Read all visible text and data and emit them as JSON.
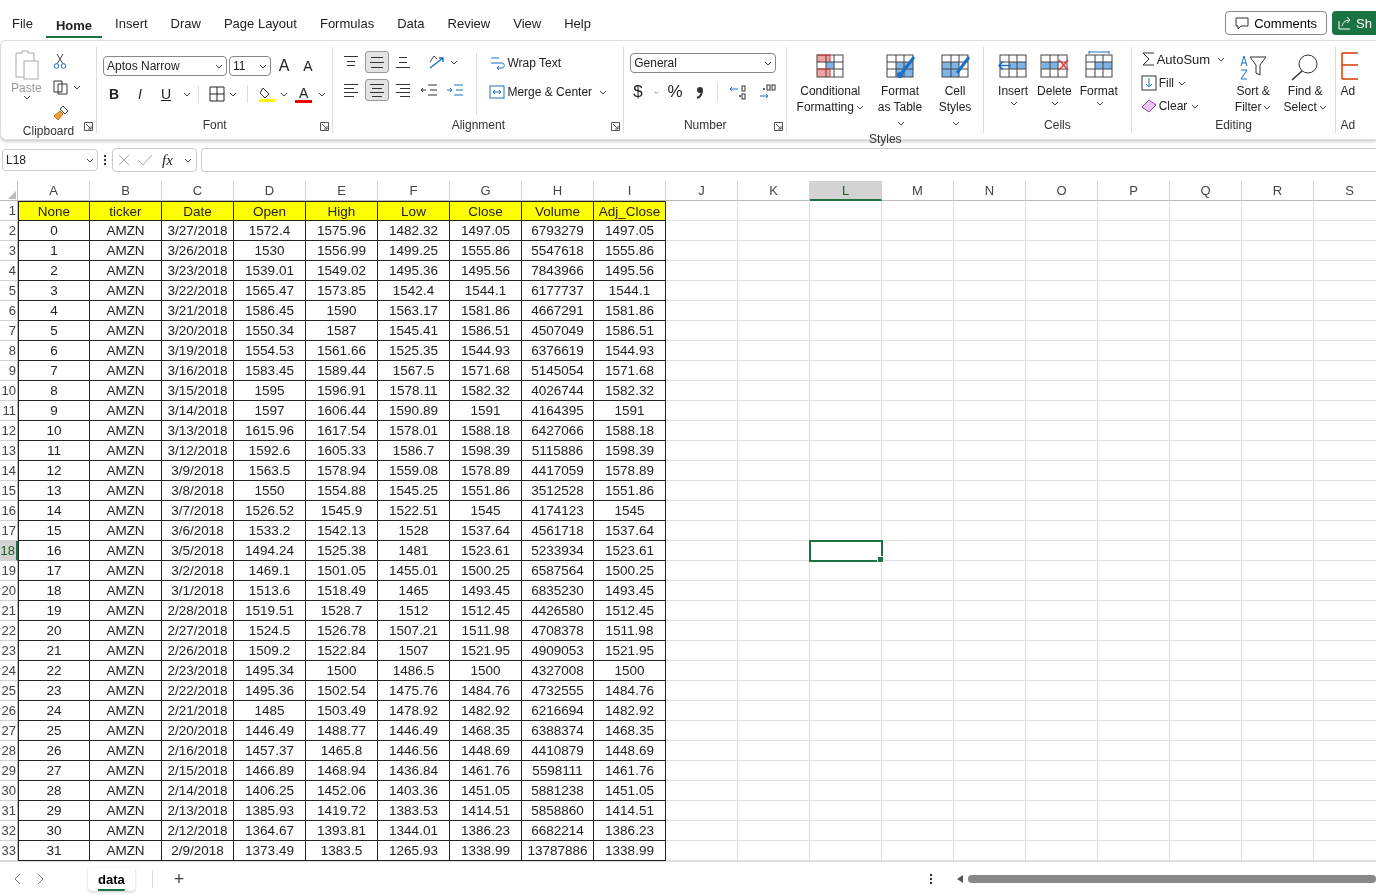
{
  "menu_tabs": [
    {
      "label": "File",
      "selected": false
    },
    {
      "label": "Home",
      "selected": true
    },
    {
      "label": "Insert",
      "selected": false
    },
    {
      "label": "Draw",
      "selected": false
    },
    {
      "label": "Page Layout",
      "selected": false
    },
    {
      "label": "Formulas",
      "selected": false
    },
    {
      "label": "Data",
      "selected": false
    },
    {
      "label": "Review",
      "selected": false
    },
    {
      "label": "View",
      "selected": false
    },
    {
      "label": "Help",
      "selected": false
    }
  ],
  "comments_button": "Comments",
  "share_button": "Sh",
  "ribbon": {
    "clipboard": {
      "title": "Clipboard",
      "paste": {
        "label": "Paste",
        "disabled": true
      }
    },
    "font": {
      "title": "Font",
      "font_name": "Aptos Narrow",
      "font_size": "11",
      "grow": "A",
      "shrink": "A",
      "bold": "B",
      "italic": "I",
      "underline": "U",
      "font_color": "A"
    },
    "alignment": {
      "title": "Alignment",
      "vertical": [
        {
          "kind": "top",
          "selected": false
        },
        {
          "kind": "middle",
          "selected": true
        },
        {
          "kind": "bottom",
          "selected": false
        }
      ],
      "horizontal": [
        {
          "kind": "left",
          "selected": false
        },
        {
          "kind": "center",
          "selected": true
        },
        {
          "kind": "right",
          "selected": false
        }
      ],
      "wrap_text": "Wrap Text",
      "merge_center": "Merge & Center"
    },
    "number": {
      "title": "Number",
      "format": "General",
      "currency": "$",
      "percent": "%"
    },
    "styles": {
      "title": "Styles",
      "buttons": [
        {
          "kind": "conditional",
          "label": "Conditional Formatting"
        },
        {
          "kind": "table",
          "label": "Format as Table"
        },
        {
          "kind": "cell_styles",
          "label": "Cell Styles"
        }
      ]
    },
    "cells": {
      "title": "Cells",
      "buttons": [
        {
          "kind": "insert",
          "label": "Insert"
        },
        {
          "kind": "delete",
          "label": "Delete"
        },
        {
          "kind": "format",
          "label": "Format"
        }
      ]
    },
    "editing": {
      "title": "Editing",
      "autosum": "AutoSum",
      "fill": "Fill",
      "clear": "Clear",
      "sort_filter": "Sort & Filter",
      "find_select": "Find & Select"
    },
    "add": {
      "label": "Ad",
      "title": "Ad"
    }
  },
  "formula_bar": {
    "name_box": "L18",
    "fx": "fx"
  },
  "sheet": {
    "columns": [
      {
        "label": "A",
        "selected": false
      },
      {
        "label": "B",
        "selected": false
      },
      {
        "label": "C",
        "selected": false
      },
      {
        "label": "D",
        "selected": false
      },
      {
        "label": "E",
        "selected": false
      },
      {
        "label": "F",
        "selected": false
      },
      {
        "label": "G",
        "selected": false
      },
      {
        "label": "H",
        "selected": false
      },
      {
        "label": "I",
        "selected": false
      },
      {
        "label": "J",
        "selected": false
      },
      {
        "label": "K",
        "selected": false
      },
      {
        "label": "L",
        "selected": true
      },
      {
        "label": "M",
        "selected": false
      },
      {
        "label": "N",
        "selected": false
      },
      {
        "label": "O",
        "selected": false
      },
      {
        "label": "P",
        "selected": false
      },
      {
        "label": "Q",
        "selected": false
      },
      {
        "label": "R",
        "selected": false
      },
      {
        "label": "S",
        "selected": false
      }
    ],
    "rows": [
      {
        "number": "1",
        "selected": false,
        "kind": "header",
        "cells": [
          "None",
          "ticker",
          "Date",
          "Open",
          "High",
          "Low",
          "Close",
          "Volume",
          "Adj_Close"
        ]
      },
      {
        "number": "2",
        "selected": false,
        "kind": "data",
        "cells": [
          "0",
          "AMZN",
          "3/27/2018",
          "1572.4",
          "1575.96",
          "1482.32",
          "1497.05",
          "6793279",
          "1497.05"
        ]
      },
      {
        "number": "3",
        "selected": false,
        "kind": "data",
        "cells": [
          "1",
          "AMZN",
          "3/26/2018",
          "1530",
          "1556.99",
          "1499.25",
          "1555.86",
          "5547618",
          "1555.86"
        ]
      },
      {
        "number": "4",
        "selected": false,
        "kind": "data",
        "cells": [
          "2",
          "AMZN",
          "3/23/2018",
          "1539.01",
          "1549.02",
          "1495.36",
          "1495.56",
          "7843966",
          "1495.56"
        ]
      },
      {
        "number": "5",
        "selected": false,
        "kind": "data",
        "cells": [
          "3",
          "AMZN",
          "3/22/2018",
          "1565.47",
          "1573.85",
          "1542.4",
          "1544.1",
          "6177737",
          "1544.1"
        ]
      },
      {
        "number": "6",
        "selected": false,
        "kind": "data",
        "cells": [
          "4",
          "AMZN",
          "3/21/2018",
          "1586.45",
          "1590",
          "1563.17",
          "1581.86",
          "4667291",
          "1581.86"
        ]
      },
      {
        "number": "7",
        "selected": false,
        "kind": "data",
        "cells": [
          "5",
          "AMZN",
          "3/20/2018",
          "1550.34",
          "1587",
          "1545.41",
          "1586.51",
          "4507049",
          "1586.51"
        ]
      },
      {
        "number": "8",
        "selected": false,
        "kind": "data",
        "cells": [
          "6",
          "AMZN",
          "3/19/2018",
          "1554.53",
          "1561.66",
          "1525.35",
          "1544.93",
          "6376619",
          "1544.93"
        ]
      },
      {
        "number": "9",
        "selected": false,
        "kind": "data",
        "cells": [
          "7",
          "AMZN",
          "3/16/2018",
          "1583.45",
          "1589.44",
          "1567.5",
          "1571.68",
          "5145054",
          "1571.68"
        ]
      },
      {
        "number": "10",
        "selected": false,
        "kind": "data",
        "cells": [
          "8",
          "AMZN",
          "3/15/2018",
          "1595",
          "1596.91",
          "1578.11",
          "1582.32",
          "4026744",
          "1582.32"
        ]
      },
      {
        "number": "11",
        "selected": false,
        "kind": "data",
        "cells": [
          "9",
          "AMZN",
          "3/14/2018",
          "1597",
          "1606.44",
          "1590.89",
          "1591",
          "4164395",
          "1591"
        ]
      },
      {
        "number": "12",
        "selected": false,
        "kind": "data",
        "cells": [
          "10",
          "AMZN",
          "3/13/2018",
          "1615.96",
          "1617.54",
          "1578.01",
          "1588.18",
          "6427066",
          "1588.18"
        ]
      },
      {
        "number": "13",
        "selected": false,
        "kind": "data",
        "cells": [
          "11",
          "AMZN",
          "3/12/2018",
          "1592.6",
          "1605.33",
          "1586.7",
          "1598.39",
          "5115886",
          "1598.39"
        ]
      },
      {
        "number": "14",
        "selected": false,
        "kind": "data",
        "cells": [
          "12",
          "AMZN",
          "3/9/2018",
          "1563.5",
          "1578.94",
          "1559.08",
          "1578.89",
          "4417059",
          "1578.89"
        ]
      },
      {
        "number": "15",
        "selected": false,
        "kind": "data",
        "cells": [
          "13",
          "AMZN",
          "3/8/2018",
          "1550",
          "1554.88",
          "1545.25",
          "1551.86",
          "3512528",
          "1551.86"
        ]
      },
      {
        "number": "16",
        "selected": false,
        "kind": "data",
        "cells": [
          "14",
          "AMZN",
          "3/7/2018",
          "1526.52",
          "1545.9",
          "1522.51",
          "1545",
          "4174123",
          "1545"
        ]
      },
      {
        "number": "17",
        "selected": false,
        "kind": "data",
        "cells": [
          "15",
          "AMZN",
          "3/6/2018",
          "1533.2",
          "1542.13",
          "1528",
          "1537.64",
          "4561718",
          "1537.64"
        ]
      },
      {
        "number": "18",
        "selected": true,
        "kind": "data",
        "cells": [
          "16",
          "AMZN",
          "3/5/2018",
          "1494.24",
          "1525.38",
          "1481",
          "1523.61",
          "5233934",
          "1523.61"
        ]
      },
      {
        "number": "19",
        "selected": false,
        "kind": "data",
        "cells": [
          "17",
          "AMZN",
          "3/2/2018",
          "1469.1",
          "1501.05",
          "1455.01",
          "1500.25",
          "6587564",
          "1500.25"
        ]
      },
      {
        "number": "20",
        "selected": false,
        "kind": "data",
        "cells": [
          "18",
          "AMZN",
          "3/1/2018",
          "1513.6",
          "1518.49",
          "1465",
          "1493.45",
          "6835230",
          "1493.45"
        ]
      },
      {
        "number": "21",
        "selected": false,
        "kind": "data",
        "cells": [
          "19",
          "AMZN",
          "2/28/2018",
          "1519.51",
          "1528.7",
          "1512",
          "1512.45",
          "4426580",
          "1512.45"
        ]
      },
      {
        "number": "22",
        "selected": false,
        "kind": "data",
        "cells": [
          "20",
          "AMZN",
          "2/27/2018",
          "1524.5",
          "1526.78",
          "1507.21",
          "1511.98",
          "4708378",
          "1511.98"
        ]
      },
      {
        "number": "23",
        "selected": false,
        "kind": "data",
        "cells": [
          "21",
          "AMZN",
          "2/26/2018",
          "1509.2",
          "1522.84",
          "1507",
          "1521.95",
          "4909053",
          "1521.95"
        ]
      },
      {
        "number": "24",
        "selected": false,
        "kind": "data",
        "cells": [
          "22",
          "AMZN",
          "2/23/2018",
          "1495.34",
          "1500",
          "1486.5",
          "1500",
          "4327008",
          "1500"
        ]
      },
      {
        "number": "25",
        "selected": false,
        "kind": "data",
        "cells": [
          "23",
          "AMZN",
          "2/22/2018",
          "1495.36",
          "1502.54",
          "1475.76",
          "1484.76",
          "4732555",
          "1484.76"
        ]
      },
      {
        "number": "26",
        "selected": false,
        "kind": "data",
        "cells": [
          "24",
          "AMZN",
          "2/21/2018",
          "1485",
          "1503.49",
          "1478.92",
          "1482.92",
          "6216694",
          "1482.92"
        ]
      },
      {
        "number": "27",
        "selected": false,
        "kind": "data",
        "cells": [
          "25",
          "AMZN",
          "2/20/2018",
          "1446.49",
          "1488.77",
          "1446.49",
          "1468.35",
          "6388374",
          "1468.35"
        ]
      },
      {
        "number": "28",
        "selected": false,
        "kind": "data",
        "cells": [
          "26",
          "AMZN",
          "2/16/2018",
          "1457.37",
          "1465.8",
          "1446.56",
          "1448.69",
          "4410879",
          "1448.69"
        ]
      },
      {
        "number": "29",
        "selected": false,
        "kind": "data",
        "cells": [
          "27",
          "AMZN",
          "2/15/2018",
          "1466.89",
          "1468.94",
          "1436.84",
          "1461.76",
          "5598111",
          "1461.76"
        ]
      },
      {
        "number": "30",
        "selected": false,
        "kind": "data",
        "cells": [
          "28",
          "AMZN",
          "2/14/2018",
          "1406.25",
          "1452.06",
          "1403.36",
          "1451.05",
          "5881238",
          "1451.05"
        ]
      },
      {
        "number": "31",
        "selected": false,
        "kind": "data",
        "cells": [
          "29",
          "AMZN",
          "2/13/2018",
          "1385.93",
          "1419.72",
          "1383.53",
          "1414.51",
          "5858860",
          "1414.51"
        ]
      },
      {
        "number": "32",
        "selected": false,
        "kind": "data",
        "cells": [
          "30",
          "AMZN",
          "2/12/2018",
          "1364.67",
          "1393.81",
          "1344.01",
          "1386.23",
          "6682214",
          "1386.23"
        ]
      },
      {
        "number": "33",
        "selected": false,
        "kind": "data",
        "cells": [
          "31",
          "AMZN",
          "2/9/2018",
          "1373.49",
          "1383.5",
          "1265.93",
          "1338.99",
          "13787886",
          "1338.99"
        ]
      }
    ]
  },
  "sheet_tabs": [
    {
      "label": "data",
      "selected": true
    }
  ],
  "add_sheet": "+"
}
